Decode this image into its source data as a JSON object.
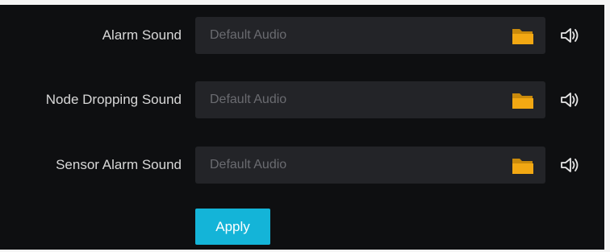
{
  "sounds": [
    {
      "label": "Alarm Sound",
      "value": "Default Audio",
      "browse_icon": "folder-icon",
      "preview_icon": "speaker-icon"
    },
    {
      "label": "Node Dropping Sound",
      "value": "Default Audio",
      "browse_icon": "folder-icon",
      "preview_icon": "speaker-icon"
    },
    {
      "label": "Sensor Alarm Sound",
      "value": "Default Audio",
      "browse_icon": "folder-icon",
      "preview_icon": "speaker-icon"
    }
  ],
  "apply_label": "Apply",
  "colors": {
    "background": "#0e0f11",
    "field": "#232428",
    "accent": "#14b4d8",
    "folder": "#f2a813",
    "text": "#d8d8d8",
    "placeholder": "#6a6b70"
  }
}
